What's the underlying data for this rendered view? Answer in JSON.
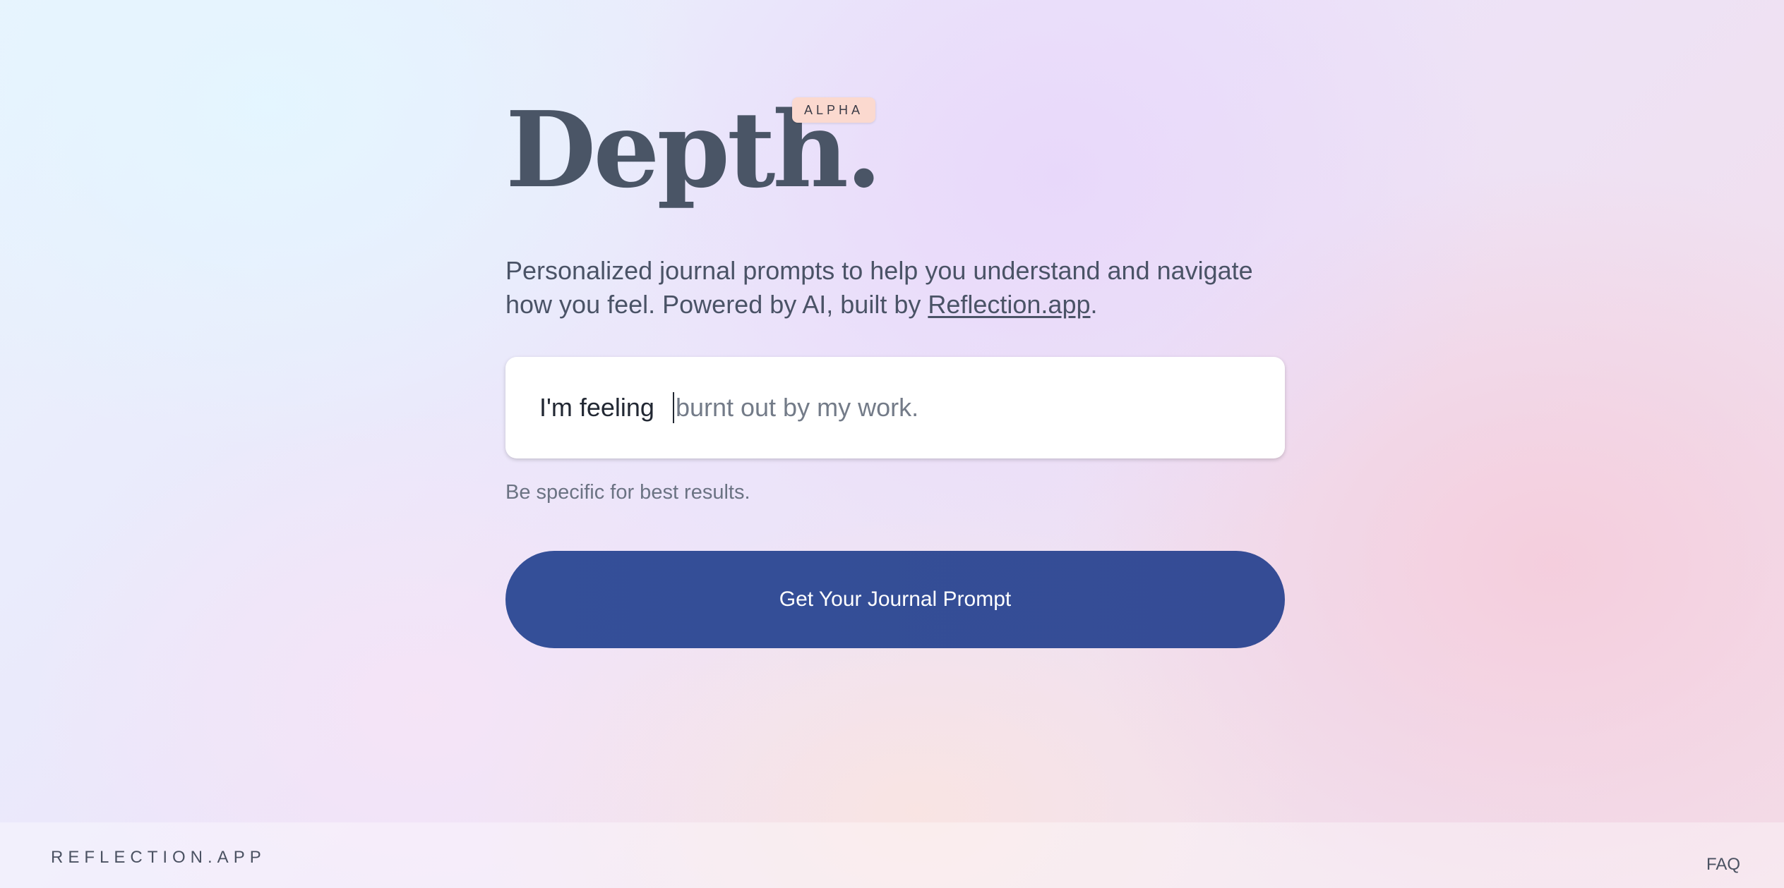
{
  "header": {
    "title": "Depth.",
    "badge": "ALPHA"
  },
  "intro": {
    "text": "Personalized journal prompts to help you understand and navigate how you feel. Powered by AI, built by ",
    "link_text": "Reflection.app",
    "suffix": "."
  },
  "feeling_input": {
    "prefix": "I'm feeling",
    "value": "",
    "placeholder": "burnt out by my work."
  },
  "hint": "Be specific for best results.",
  "cta_label": "Get Your Journal Prompt",
  "footer": {
    "brand": "REFLECTION.APP",
    "faq": "FAQ"
  },
  "colors": {
    "title": "#4a5566",
    "badge_bg": "#fbd9cf",
    "button_bg": "#344f98",
    "button_text": "#ffffff"
  }
}
